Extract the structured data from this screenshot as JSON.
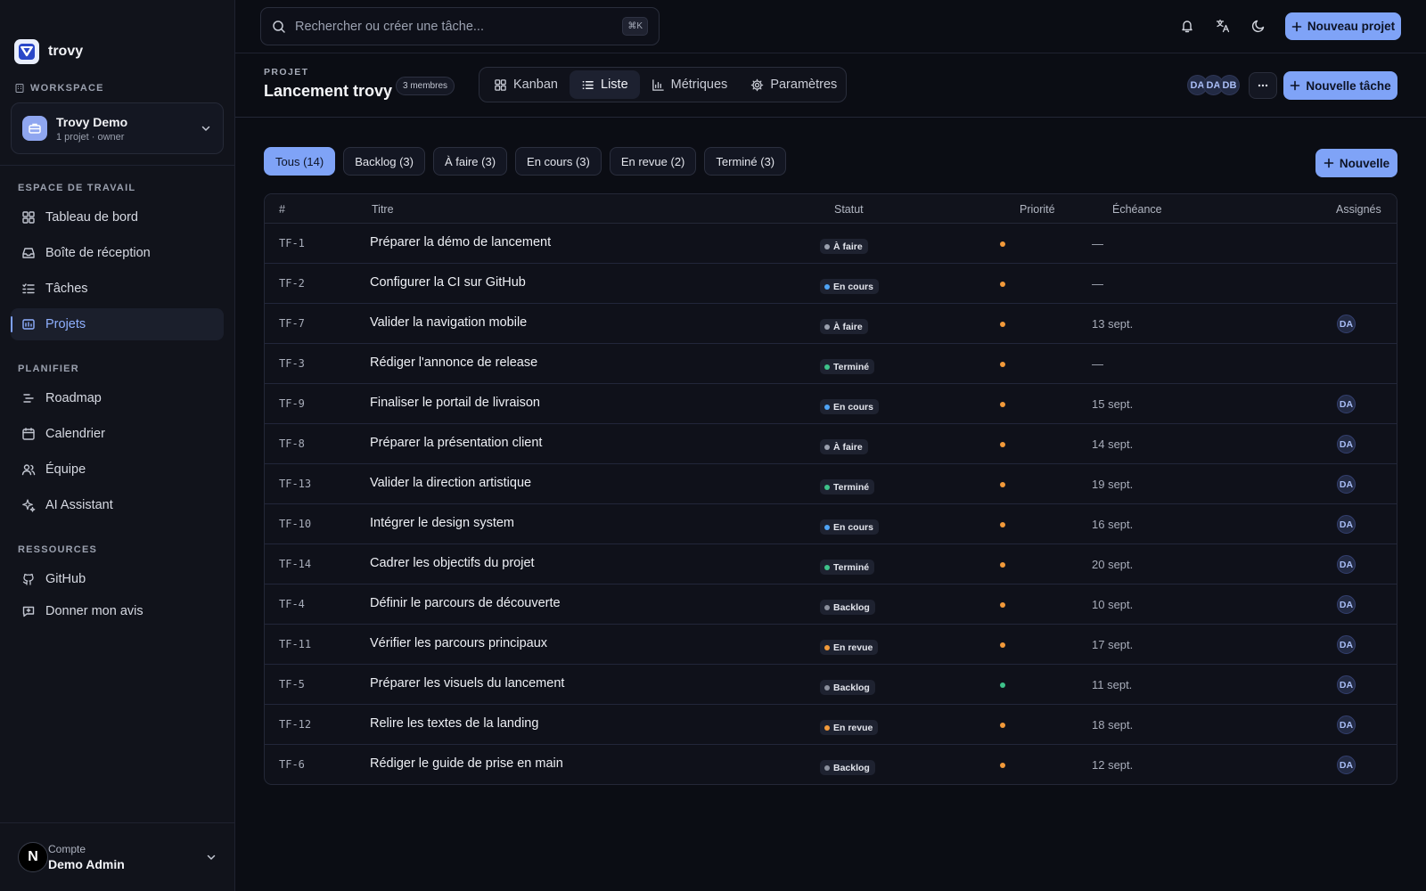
{
  "app": {
    "name": "trovy"
  },
  "workspace": {
    "label": "WORKSPACE",
    "name": "Trovy Demo",
    "meta": "1 projet · owner"
  },
  "sidebar": {
    "sections": [
      {
        "title": "ESPACE DE TRAVAIL",
        "items": [
          {
            "label": "Tableau de bord",
            "icon": "dashboard-icon"
          },
          {
            "label": "Boîte de réception",
            "icon": "inbox-icon"
          },
          {
            "label": "Tâches",
            "icon": "tasks-icon"
          },
          {
            "label": "Projets",
            "icon": "projects-icon",
            "active": true
          }
        ]
      },
      {
        "title": "PLANIFIER",
        "items": [
          {
            "label": "Roadmap",
            "icon": "roadmap-icon"
          },
          {
            "label": "Calendrier",
            "icon": "calendar-icon"
          },
          {
            "label": "Équipe",
            "icon": "team-icon"
          },
          {
            "label": "AI Assistant",
            "icon": "sparkles-icon"
          }
        ]
      },
      {
        "title": "RESSOURCES",
        "items": [
          {
            "label": "GitHub",
            "icon": "github-icon"
          },
          {
            "label": "Donner mon avis",
            "icon": "feedback-icon"
          }
        ]
      }
    ]
  },
  "account": {
    "label": "Compte",
    "name": "Demo Admin",
    "initial": "N"
  },
  "topbar": {
    "search_placeholder": "Rechercher ou créer une tâche...",
    "shortcut": "⌘K",
    "new_project": "Nouveau projet"
  },
  "project": {
    "kicker": "PROJET",
    "title": "Lancement trovy",
    "members": "3 membres",
    "tabs": [
      {
        "label": "Kanban",
        "icon": "kanban-icon"
      },
      {
        "label": "Liste",
        "icon": "list-icon",
        "active": true
      },
      {
        "label": "Métriques",
        "icon": "chart-icon"
      },
      {
        "label": "Paramètres",
        "icon": "gear-icon"
      }
    ],
    "avatars": [
      "DA",
      "DA",
      "DB"
    ],
    "new_task": "Nouvelle tâche"
  },
  "filters": [
    {
      "label": "Tous (14)",
      "active": true
    },
    {
      "label": "Backlog (3)"
    },
    {
      "label": "À faire (3)"
    },
    {
      "label": "En cours (3)"
    },
    {
      "label": "En revue (2)"
    },
    {
      "label": "Terminé (3)"
    }
  ],
  "new_small": "Nouvelle",
  "colors": {
    "accent": "#7fa3f7",
    "status": {
      "À faire": "#9aa0ae",
      "En cours": "#4ea3f5",
      "Terminé": "#3ec28a",
      "Backlog": "#8a8f9c",
      "En revue": "#f29a3a"
    },
    "priority": {
      "high": "#f29a3a",
      "low": "#3ec28a"
    }
  },
  "table": {
    "headers": {
      "id": "#",
      "title": "Titre",
      "status": "Statut",
      "priority": "Priorité",
      "due": "Échéance",
      "assignees": "Assignés"
    },
    "rows": [
      {
        "id": "TF-1",
        "title": "Préparer la démo de lancement",
        "status": "À faire",
        "priority": "high",
        "due": "—",
        "assignee": ""
      },
      {
        "id": "TF-2",
        "title": "Configurer la CI sur GitHub",
        "status": "En cours",
        "priority": "high",
        "due": "—",
        "assignee": ""
      },
      {
        "id": "TF-7",
        "title": "Valider la navigation mobile",
        "status": "À faire",
        "priority": "high",
        "due": "13 sept.",
        "assignee": "DA"
      },
      {
        "id": "TF-3",
        "title": "Rédiger l'annonce de release",
        "status": "Terminé",
        "priority": "high",
        "due": "—",
        "assignee": ""
      },
      {
        "id": "TF-9",
        "title": "Finaliser le portail de livraison",
        "status": "En cours",
        "priority": "high",
        "due": "15 sept.",
        "assignee": "DA"
      },
      {
        "id": "TF-8",
        "title": "Préparer la présentation client",
        "status": "À faire",
        "priority": "high",
        "due": "14 sept.",
        "assignee": "DA"
      },
      {
        "id": "TF-13",
        "title": "Valider la direction artistique",
        "status": "Terminé",
        "priority": "high",
        "due": "19 sept.",
        "assignee": "DA"
      },
      {
        "id": "TF-10",
        "title": "Intégrer le design system",
        "status": "En cours",
        "priority": "high",
        "due": "16 sept.",
        "assignee": "DA"
      },
      {
        "id": "TF-14",
        "title": "Cadrer les objectifs du projet",
        "status": "Terminé",
        "priority": "high",
        "due": "20 sept.",
        "assignee": "DA"
      },
      {
        "id": "TF-4",
        "title": "Définir le parcours de découverte",
        "status": "Backlog",
        "priority": "high",
        "due": "10 sept.",
        "assignee": "DA"
      },
      {
        "id": "TF-11",
        "title": "Vérifier les parcours principaux",
        "status": "En revue",
        "priority": "high",
        "due": "17 sept.",
        "assignee": "DA"
      },
      {
        "id": "TF-5",
        "title": "Préparer les visuels du lancement",
        "status": "Backlog",
        "priority": "low",
        "due": "11 sept.",
        "assignee": "DA"
      },
      {
        "id": "TF-12",
        "title": "Relire les textes de la landing",
        "status": "En revue",
        "priority": "high",
        "due": "18 sept.",
        "assignee": "DA"
      },
      {
        "id": "TF-6",
        "title": "Rédiger le guide de prise en main",
        "status": "Backlog",
        "priority": "high",
        "due": "12 sept.",
        "assignee": "DA"
      }
    ]
  }
}
